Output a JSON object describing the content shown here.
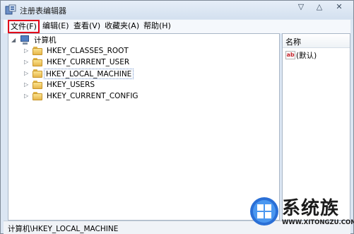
{
  "window": {
    "title": "注册表编辑器",
    "controls": [
      "▽",
      "△",
      "✕"
    ]
  },
  "menu": {
    "file": "文件(F)",
    "edit": "编辑(E)",
    "view": "查看(V)",
    "favorites": "收藏夹(A)",
    "help": "帮助(H)"
  },
  "tree": {
    "root": "计算机",
    "root_expander": "◢",
    "collapsed_marker": "▷",
    "nodes": [
      "HKEY_CLASSES_ROOT",
      "HKEY_CURRENT_USER",
      "HKEY_LOCAL_MACHINE",
      "HKEY_USERS",
      "HKEY_CURRENT_CONFIG"
    ],
    "selected": "HKEY_LOCAL_MACHINE"
  },
  "list": {
    "header": "名称",
    "icon_text": "ab",
    "default_entry": "(默认)"
  },
  "status": {
    "path": "计算机\\HKEY_LOCAL_MACHINE"
  },
  "watermark": {
    "title": "系统族",
    "url": "WWW.XITONGZU.COM"
  },
  "colors": {
    "highlight_border": "#e2001a",
    "window_frame": "#dbe6f3",
    "folder": "#e6b64c"
  }
}
